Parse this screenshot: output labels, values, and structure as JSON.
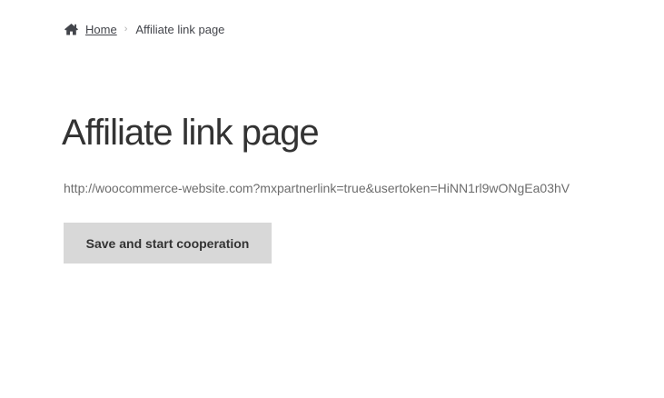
{
  "breadcrumb": {
    "home_icon": "home-icon",
    "home_label": "Home",
    "separator": "›",
    "current_label": "Affiliate link page"
  },
  "page": {
    "title": "Affiliate link page",
    "affiliate_url": "http://woocommerce-website.com?mxpartnerlink=true&usertoken=HiNN1rl9wONgEa03hV",
    "button_label": "Save and start cooperation"
  },
  "colors": {
    "text": "#43454b",
    "title": "#333333",
    "url_text": "#6d6d6d",
    "button_bg": "#d8d8d8"
  }
}
